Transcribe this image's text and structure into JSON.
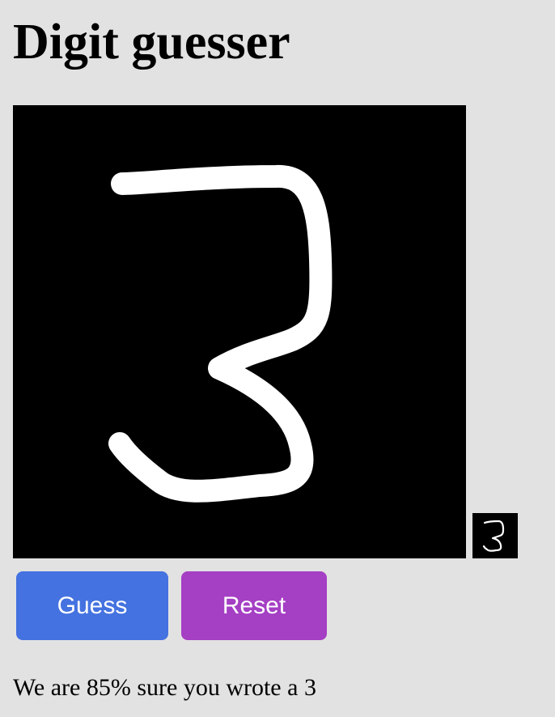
{
  "page": {
    "title": "Digit guesser"
  },
  "canvas": {
    "background": "#000000",
    "stroke_color": "#ffffff",
    "drawn_digit": "3"
  },
  "preview": {
    "drawn_digit": "3"
  },
  "buttons": {
    "guess_label": "Guess",
    "guess_color": "#4472e0",
    "reset_label": "Reset",
    "reset_color": "#a53fc4"
  },
  "result": {
    "text": "We are 85% sure you wrote a 3",
    "confidence_percent": 85,
    "predicted_digit": "3"
  }
}
